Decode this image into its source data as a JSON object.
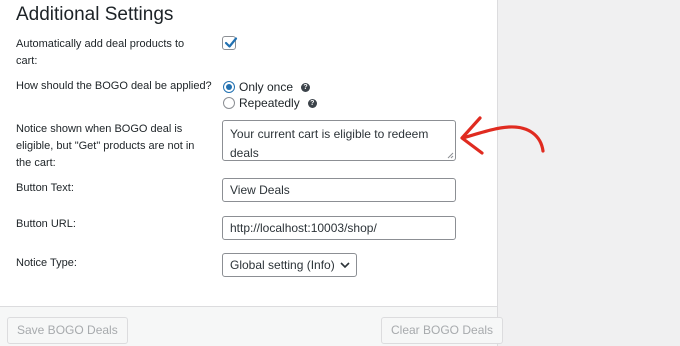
{
  "section": {
    "title": "Additional Settings"
  },
  "fields": {
    "auto_add": {
      "label_line1": "Automatically add deal products to",
      "label_line2": "cart:",
      "checked": true
    },
    "apply": {
      "label": "How should the BOGO deal be applied?",
      "options": [
        {
          "label": "Only once",
          "selected": true
        },
        {
          "label": "Repeatedly",
          "selected": false
        }
      ],
      "help_glyph": "?"
    },
    "notice": {
      "label_line1": "Notice shown when BOGO deal is",
      "label_line2": "eligible, but \"Get\" products are not in",
      "label_line3": "the cart:",
      "value_line1": "Your current cart is eligible to redeem",
      "value_line2": "deals"
    },
    "button_text": {
      "label": "Button Text:",
      "value": "View Deals"
    },
    "button_url": {
      "label": "Button URL:",
      "value": "http://localhost:10003/shop/"
    },
    "notice_type": {
      "label": "Notice Type:",
      "value": "Global setting (Info)"
    }
  },
  "footer": {
    "save_label": "Save BOGO Deals",
    "clear_label": "Clear BOGO Deals"
  },
  "annotation": {
    "arrow_color": "#e02b20"
  },
  "icons": {
    "check": "checkmark-icon",
    "help": "help-icon",
    "dropdown": "chevron-down-icon",
    "arrow": "red-arrow-icon"
  }
}
